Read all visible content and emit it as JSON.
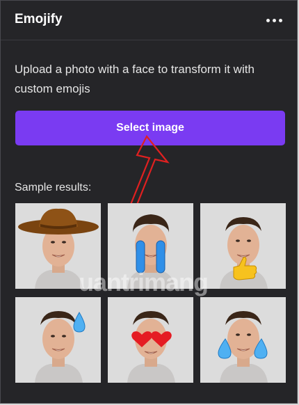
{
  "header": {
    "title": "Emojify",
    "menu_icon": "more-horizontal-icon"
  },
  "intro_text": "Upload a photo with a face to transform it with custom emojis",
  "select_button": {
    "label": "Select image"
  },
  "samples": {
    "label": "Sample results:",
    "items": [
      {
        "name": "sample-cowboy-hat",
        "emoji": "cowboy-hat"
      },
      {
        "name": "sample-crying-tears",
        "emoji": "streaming-tears"
      },
      {
        "name": "sample-thumbs-up",
        "emoji": "thumbs-up"
      },
      {
        "name": "sample-sweat-drop",
        "emoji": "sweat-drop"
      },
      {
        "name": "sample-heart-eyes",
        "emoji": "heart-eyes"
      },
      {
        "name": "sample-teardrops",
        "emoji": "teardrops"
      }
    ]
  },
  "watermark": "uantrimang",
  "colors": {
    "accent": "#7a3bf2",
    "panel": "#252528",
    "annotation": "#e02020"
  }
}
